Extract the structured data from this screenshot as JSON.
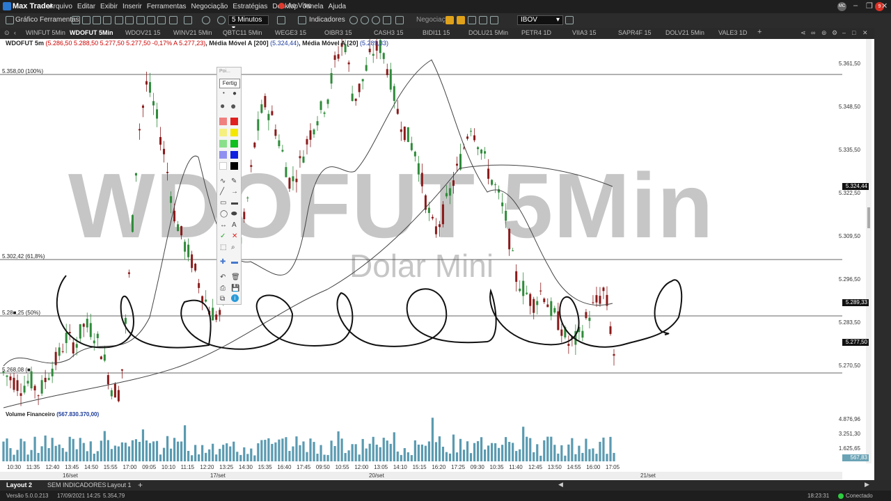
{
  "titlebar": {
    "app_name": "Max Trader",
    "menu": [
      "Arquivo",
      "Editar",
      "Exibir",
      "Inserir",
      "Ferramentas",
      "Negociação",
      "Estratégias",
      "Desktop",
      "Janela",
      "Ajuda"
    ],
    "live": "Ao Vivo",
    "user_badge": "MC"
  },
  "toolbar": {
    "grafico": "Gráfico",
    "ferramentas": "Ferramentas",
    "interval": "5 Minutos",
    "indicadores": "Indicadores",
    "negociacao": "Negociação",
    "symbol": "IBOV"
  },
  "tabs": [
    "WINFUT 5Min",
    "WDOFUT 5Min",
    "WDOV21 15",
    "WINV21 5Min",
    "QBTC11 5Min",
    "WEGE3 15",
    "OIBR3 15",
    "CASH3 15",
    "BIDI11 15",
    "DOLU21 5Min",
    "PETR4 1D",
    "VIIA3 15",
    "SAPR4F 15",
    "DOLV21 5Min",
    "VALE3 1D"
  ],
  "active_tab": 1,
  "header": {
    "symbol": "WDOFUT 5m",
    "quote": "(5.286,50  5.288,50  5.277,50  5.277,50  -0,17%  A 5.277,23)",
    "ma200_label": ", Média Móvel A [200]",
    "ma200_value": "(5.324,44)",
    "ma20_label": ", Média Móvel A [20]",
    "ma20_value": "(5.289,33)"
  },
  "watermark": {
    "title": "WDOFUT 5Min",
    "subtitle": "Dolar Mini"
  },
  "fib_levels": [
    {
      "label": "5.358,00 (100%)",
      "price": 5358.0
    },
    {
      "label": "5.302,42 (61,8%)",
      "price": 5302.42
    },
    {
      "label": "5.28■,25 (50%)",
      "price": 5284.25
    },
    {
      "label": "5.268,08 (■",
      "price": 5266.08
    }
  ],
  "price_axis": [
    "5.361,50",
    "5.348,50",
    "5.335,50",
    "5.322,50",
    "5.309,50",
    "5.296,50",
    "5.283,50",
    "5.270,50"
  ],
  "price_markers": [
    {
      "value": "5.324,44",
      "price": 5324.44
    },
    {
      "value": "5.289,33",
      "price": 5289.33
    },
    {
      "value": "5.277,50",
      "price": 5277.5
    }
  ],
  "volume": {
    "title": "Volume Financeiro",
    "value": "(567.830.370,00)",
    "axis": [
      "4.876,96",
      "3.251,30",
      "1.625,65"
    ],
    "marker": "567,83"
  },
  "time_axis": [
    "10:30",
    "11:35",
    "12:40",
    "13:45",
    "14:50",
    "15:55",
    "17:00",
    "09:05",
    "10:10",
    "11:15",
    "12:20",
    "13:25",
    "14:30",
    "15:35",
    "16:40",
    "17:45",
    "09:50",
    "10:55",
    "12:00",
    "13:05",
    "14:10",
    "15:15",
    "16:20",
    "17:25",
    "09:30",
    "10:35",
    "11:40",
    "12:45",
    "13:50",
    "14:55",
    "16:00",
    "17:05"
  ],
  "date_axis": [
    "16/set",
    "17/set",
    "20/set",
    "21/set"
  ],
  "palette": {
    "title": "Poi...",
    "done": "Fertig"
  },
  "layouts": {
    "active": "Layout 2",
    "items": [
      "SEM INDICADORES",
      "Layout 1"
    ],
    "add": "+"
  },
  "status": {
    "version": "Versão 5.0.0.213",
    "datetime": "17/09/2021 14:25",
    "price": "5.354,79",
    "clock": "18:23:31",
    "connection": "Conectado"
  },
  "colors": {
    "up": "#2e8b3a",
    "down": "#8b1a1a",
    "volume": "#5a9ab0",
    "accent_live": "#e03a2f",
    "connected": "#2ecc40"
  },
  "chart_data": {
    "type": "candlestick",
    "price_range": [
      5264,
      5368
    ],
    "series": [
      {
        "name": "Média Móvel A [200]",
        "last": 5324.44
      },
      {
        "name": "Média Móvel A [20]",
        "last": 5289.33
      }
    ],
    "close_path": [
      5272,
      5270,
      5268,
      5270,
      5266,
      5272,
      5276,
      5282,
      5280,
      5286,
      5284,
      5278,
      5268,
      5266,
      5300,
      5340,
      5356,
      5346,
      5334,
      5318,
      5310,
      5304,
      5296,
      5290,
      5288,
      5296,
      5305,
      5318,
      5338,
      5350,
      5345,
      5336,
      5326,
      5332,
      5340,
      5346,
      5350,
      5362,
      5368,
      5350,
      5356,
      5364,
      5366,
      5358,
      5346,
      5340,
      5335,
      5322,
      5312,
      5318,
      5326,
      5334,
      5344,
      5338,
      5330,
      5324,
      5316,
      5300,
      5296,
      5292,
      5296,
      5290,
      5286,
      5280,
      5282,
      5288,
      5292,
      5296,
      5277.5
    ]
  }
}
